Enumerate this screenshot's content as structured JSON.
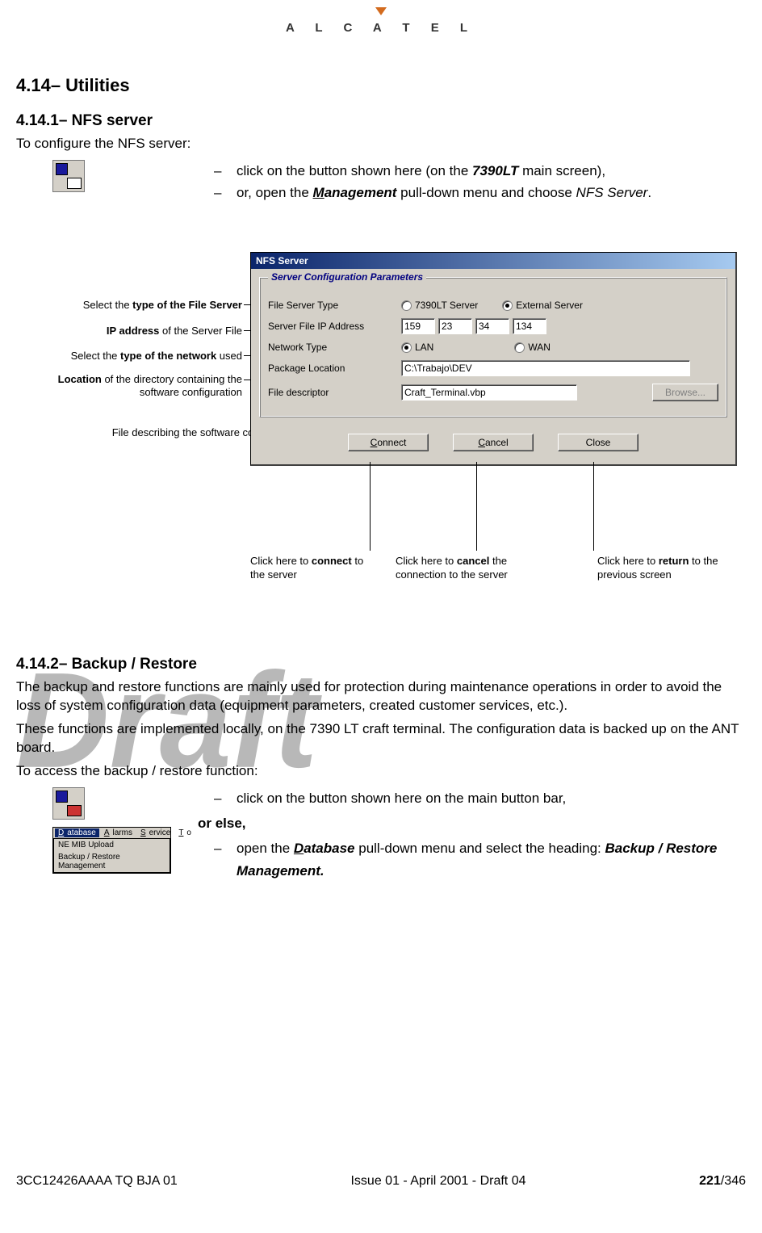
{
  "brand": "A L C A T E L",
  "section_title": "4.14– Utilities",
  "sub1_title": "4.14.1– NFS server",
  "sub1_intro": "To configure the NFS server:",
  "sub1_bullets": {
    "b1_pre": "click on the button shown here (on the ",
    "b1_bold": "7390LT",
    "b1_post": " main screen),",
    "b2_pre": "or, open the ",
    "b2_m": "M",
    "b2_mgmt": "anagement",
    "b2_mid": " pull-down menu and choose ",
    "b2_nfs": "NFS Server",
    "b2_post": "."
  },
  "callouts": {
    "c1_a": "Select the ",
    "c1_b": "type of the File Server",
    "c2_a": "IP address",
    "c2_b": " of the Server File",
    "c3_a": "Select the ",
    "c3_b": "type of the network",
    "c3_c": " used",
    "c4_a": "Location",
    "c4_b": " of the directory containing the software configuration",
    "c5": "File describing the software configuration",
    "cb1_a": "Click here to ",
    "cb1_b": "connect",
    "cb1_c": " to the server",
    "cb2_a": "Click here to ",
    "cb2_b": "cancel",
    "cb2_c": " the connection to the server",
    "cb3_a": "Click here to ",
    "cb3_b": "return",
    "cb3_c": " to the previous screen"
  },
  "dialog": {
    "title": "NFS Server",
    "group": "Server Configuration Parameters",
    "labels": {
      "fst": "File Server Type",
      "ip": "Server File IP Address",
      "nt": "Network Type",
      "pkg": "Package Location",
      "fd": "File descriptor"
    },
    "radios": {
      "srv7390": "7390LT Server",
      "ext": "External Server",
      "lan": "LAN",
      "wan": "WAN"
    },
    "ip": {
      "a": "159",
      "b": "23",
      "c": "34",
      "d": "134"
    },
    "pkg_val": "C:\\Trabajo\\DEV",
    "fd_val": "Craft_Terminal.vbp",
    "browse": "Browse...",
    "connect_c": "C",
    "connect_rest": "onnect",
    "cancel_c": "C",
    "cancel_rest": "ancel",
    "close": "Close"
  },
  "sub2_title": "4.14.2– Backup / Restore",
  "sub2_p1": "The backup and restore functions are mainly used for protection during maintenance operations in order to avoid the loss of system configuration data (equipment parameters, created customer services, etc.).",
  "sub2_p2": "These functions are implemented locally, on the 7390 LT craft terminal. The configuration data is backed up on the ANT board.",
  "sub2_p3": "To access the backup / restore function:",
  "sub2_bullets": {
    "b1": "click on the button shown here on the main button bar,",
    "or": "or else,",
    "b2_pre": "open the ",
    "b2_d": "D",
    "b2_db": "atabase",
    "b2_mid": " pull-down menu and select the heading: ",
    "b2_head": "Backup / Restore Management."
  },
  "menu": {
    "m_db_d": "D",
    "m_db": "atabase",
    "m_al_a": "A",
    "m_al": "larms",
    "m_sv_s": "S",
    "m_sv": "ervice",
    "m_to_t": "T",
    "m_to": "o",
    "item1": "NE MIB Upload",
    "item2": "Backup / Restore Management"
  },
  "watermark": "Draft",
  "footer": {
    "left": "3CC12426AAAA TQ BJA 01",
    "center": "Issue 01 - April 2001 - Draft 04",
    "right_b": "221",
    "right_rest": "/346"
  }
}
